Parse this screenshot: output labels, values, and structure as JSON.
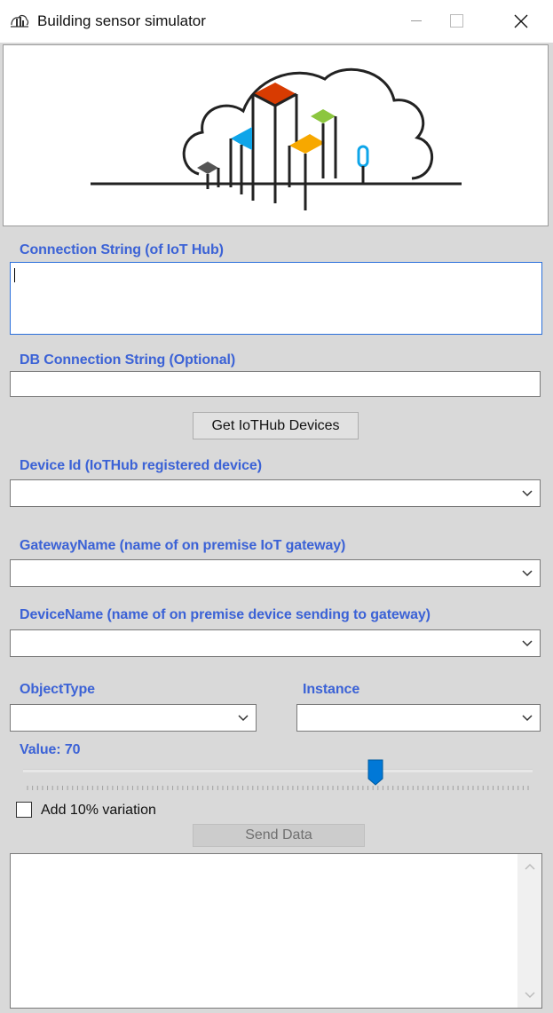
{
  "window": {
    "title": "Building sensor simulator"
  },
  "form": {
    "connection_label": "Connection String (of IoT Hub)",
    "connection_value": "",
    "db_label": "DB Connection String (Optional)",
    "db_value": "",
    "get_devices_button": "Get IoTHub Devices",
    "device_id_label": "Device Id (IoTHub registered device)",
    "device_id_selected": "",
    "gateway_label": "GatewayName (name of on premise IoT gateway)",
    "gateway_selected": "",
    "device_name_label": "DeviceName (name of on premise device sending to gateway)",
    "device_name_selected": "",
    "object_type_label": "ObjectType",
    "object_type_selected": "",
    "instance_label": "Instance",
    "instance_selected": "",
    "value_label": "Value: 70",
    "slider_value": 70,
    "variation_label": "Add 10% variation",
    "variation_checked": false,
    "send_button": "Send Data",
    "output_text": ""
  },
  "colors": {
    "label_blue": "#3b62d6",
    "accent": "#0078d7"
  }
}
